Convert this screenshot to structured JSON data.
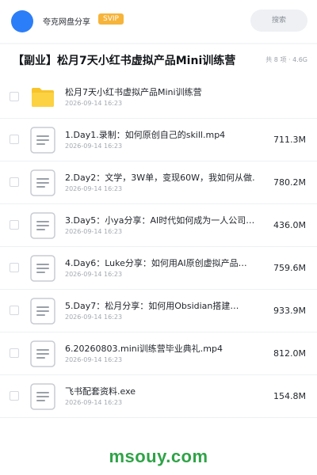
{
  "header": {
    "user_name": "夸克网盘分享",
    "badge": "SVIP",
    "search_label": "搜索",
    "accent_color": "#2c7ef8",
    "badge_color": "#f6b43a"
  },
  "folder": {
    "title": "【副业】松月7天小红书虚拟产品Mini训练营",
    "meta": "共 8 项 · 4.6G"
  },
  "files": [
    {
      "icon": "folder-icon",
      "name": "松月7天小红书虚拟产品Mini训练营",
      "date": "2026-09-14 16:23",
      "size": ""
    },
    {
      "icon": "document-icon",
      "name": "1.Day1.录制：如何原创自己的skill.mp4",
      "date": "2026-09-14 16:23",
      "size": "711.3M"
    },
    {
      "icon": "document-icon",
      "name": "2.Day2：文学，3W单，变现60W，我如何从做…",
      "date": "2026-09-14 16:23",
      "size": "780.2M"
    },
    {
      "icon": "document-icon",
      "name": "3.Day5：小ya分享：AI时代如何成为一人公司…",
      "date": "2026-09-14 16:23",
      "size": "436.0M"
    },
    {
      "icon": "document-icon",
      "name": "4.Day6：Luke分享：如何用AI原创虚拟产品…",
      "date": "2026-09-14 16:23",
      "size": "759.6M"
    },
    {
      "icon": "document-icon",
      "name": "5.Day7：松月分享：如何用Obsidian搭建…",
      "date": "2026-09-14 16:23",
      "size": "933.9M"
    },
    {
      "icon": "document-icon",
      "name": "6.20260803.mini训练营毕业典礼.mp4",
      "date": "2026-09-14 16:23",
      "size": "812.0M"
    },
    {
      "icon": "document-icon",
      "name": "飞书配套资料.exe",
      "date": "2026-09-14 16:23",
      "size": "154.8M"
    }
  ],
  "footer": {
    "watermark": "msouy.com",
    "watermark_color": "#2fa347"
  }
}
